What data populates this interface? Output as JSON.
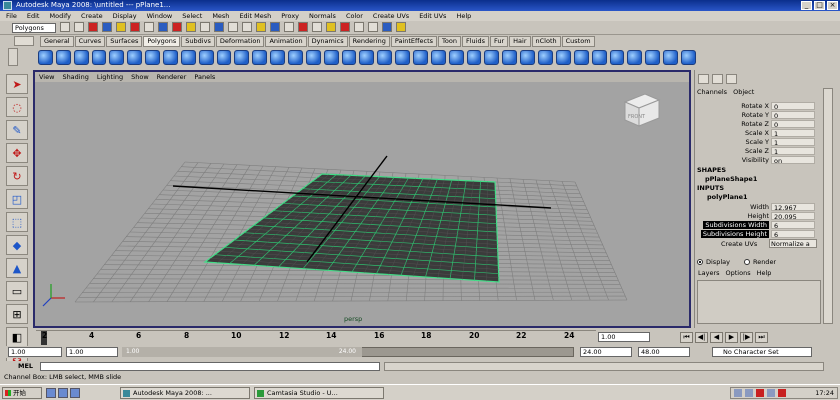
{
  "window": {
    "title": "Autodesk Maya 2008: \\untitled   ---   pPlane1...",
    "minimize": "_",
    "maximize": "□",
    "close": "×"
  },
  "menubar": [
    "File",
    "Edit",
    "Modify",
    "Create",
    "Display",
    "Window",
    "Select",
    "Mesh",
    "Edit Mesh",
    "Proxy",
    "Normals",
    "Color",
    "Create UVs",
    "Edit UVs",
    "Help"
  ],
  "statusline": {
    "mode": "Polygons"
  },
  "shelf_tabs": [
    "General",
    "Curves",
    "Surfaces",
    "Polygons",
    "Subdivs",
    "Deformation",
    "Animation",
    "Dynamics",
    "Rendering",
    "PaintEffects",
    "Toon",
    "Fluids",
    "Fur",
    "Hair",
    "nCloth",
    "Custom"
  ],
  "shelf_active_tab": "Polygons",
  "viewport": {
    "menu": [
      "View",
      "Shading",
      "Lighting",
      "Show",
      "Renderer",
      "Panels"
    ],
    "camera": "persp",
    "viewcube_label": "FRONT"
  },
  "channel_box": {
    "menu": [
      "Channels",
      "Object"
    ],
    "transform_attrs": [
      {
        "label": "Rotate X",
        "value": "0"
      },
      {
        "label": "Rotate Y",
        "value": "0"
      },
      {
        "label": "Rotate Z",
        "value": "0"
      },
      {
        "label": "Scale X",
        "value": "1"
      },
      {
        "label": "Scale Y",
        "value": "1"
      },
      {
        "label": "Scale Z",
        "value": "1"
      },
      {
        "label": "Visibility",
        "value": "on"
      }
    ],
    "shapes_header": "SHAPES",
    "shape_name": "pPlaneShape1",
    "inputs_header": "INPUTS",
    "input_name": "polyPlane1",
    "input_attrs": [
      {
        "label": "Width",
        "value": "12.967"
      },
      {
        "label": "Height",
        "value": "20.095"
      },
      {
        "label": "Subdivisions Width",
        "value": "6"
      },
      {
        "label": "Subdivisions Height",
        "value": "6"
      }
    ],
    "create_uvs_label": "Create UVs",
    "create_uvs_value": "Normalize a"
  },
  "layer_editor": {
    "display_radio": "Display",
    "render_radio": "Render",
    "menu": [
      "Layers",
      "Options",
      "Help"
    ]
  },
  "timeline": {
    "ticks": [
      "2",
      "4",
      "6",
      "8",
      "10",
      "12",
      "14",
      "16",
      "18",
      "20",
      "22",
      "24"
    ],
    "current_frame": "1.00"
  },
  "range": {
    "start_time": "1.00",
    "playback_start": "1.00",
    "handle_start": "1.00",
    "handle_end": "24.00",
    "playback_end": "24.00",
    "end_time": "48.00",
    "character_set": "No Character Set"
  },
  "command_line": {
    "label": "MEL"
  },
  "help_line": "Channel Box: LMB select, MMB slide",
  "taskbar": {
    "start": "开始",
    "tasks": [
      "Autodesk Maya 2008: ...",
      "Camtasia Studio - U..."
    ],
    "clock": "17:24"
  }
}
